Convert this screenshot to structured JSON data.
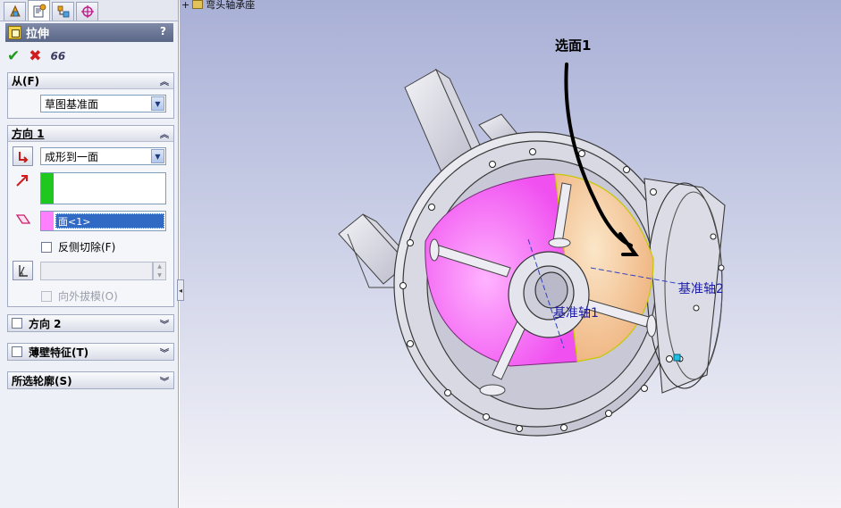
{
  "tree": {
    "item_label": "弯头轴承座"
  },
  "feature": {
    "title": "拉伸",
    "help": "?"
  },
  "actions": {
    "ok": "✔",
    "cancel": "✖",
    "detail_preview": "66"
  },
  "from_group": {
    "header": "从(F)",
    "start_condition": "草图基准面"
  },
  "direction1": {
    "header": "方向 1",
    "end_condition": "成形到一面",
    "selected_face": "面<1>",
    "flip_side_cut_label": "反侧切除(F)",
    "draft_outward_label": "向外拔模(O)"
  },
  "direction2": {
    "header": "方向 2"
  },
  "thin_feature": {
    "header": "薄壁特征(T)"
  },
  "selected_contours": {
    "header": "所选轮廓(S)"
  },
  "viewport": {
    "annotation": "选面1",
    "axis1_label": "基准轴1",
    "axis2_label": "基准轴2"
  },
  "colors": {
    "panel_bg": "#eef0f7",
    "title_bar": "#6a7596",
    "selection_face": "#ff66ff",
    "selected_face_highlight": "#f6c8a0",
    "axis_label": "#1a1aa6",
    "selection_field": "#316ac5"
  },
  "icons": [
    "feature-manager-icon",
    "property-manager-icon",
    "configuration-manager-icon",
    "dimxpert-icon",
    "extrude-icon",
    "ok-icon",
    "cancel-icon",
    "detail-preview-icon",
    "reverse-direction-icon",
    "direction-arrow-icon",
    "face-select-icon",
    "draft-icon",
    "chevron-up-icon",
    "chevron-down-icon"
  ]
}
